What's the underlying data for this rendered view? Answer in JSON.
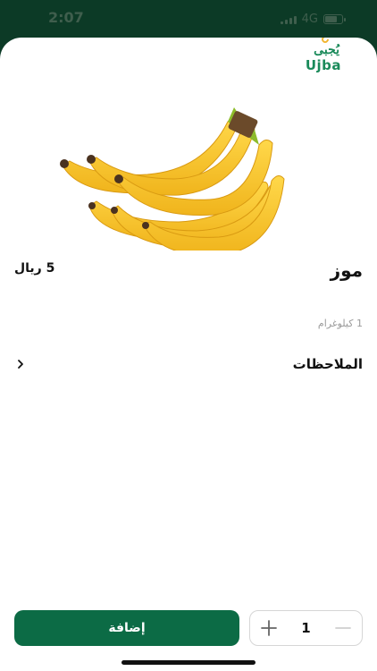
{
  "status_bar": {
    "time": "2:07",
    "network": "4G"
  },
  "brand": {
    "arabic": "يُجبى",
    "latin": "Ujba"
  },
  "product": {
    "name": "موز",
    "price": "5 ريال",
    "unit": "1 كيلوغرام",
    "image_alt": "banana-bunch"
  },
  "notes": {
    "label": "الملاحظات"
  },
  "cart": {
    "quantity": "1",
    "add_label": "إضافة"
  },
  "colors": {
    "primary": "#0c6b45",
    "header": "#0c3a26",
    "banana": "#f5c518"
  }
}
